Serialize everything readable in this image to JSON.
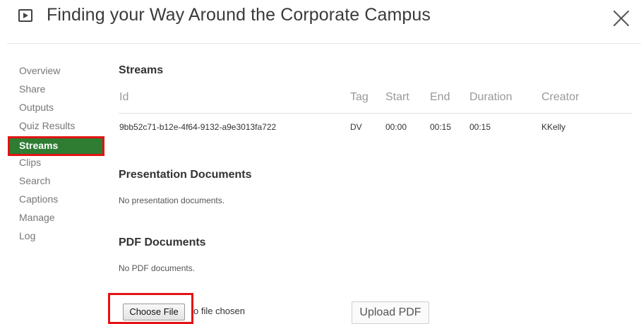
{
  "header": {
    "title": "Finding your Way Around the Corporate Campus",
    "play_icon": "play-icon",
    "close_icon": "close-icon"
  },
  "sidebar": {
    "items": [
      {
        "label": "Overview"
      },
      {
        "label": "Share"
      },
      {
        "label": "Outputs"
      },
      {
        "label": "Quiz Results"
      },
      {
        "label": "Streams",
        "active": true
      },
      {
        "label": "Clips"
      },
      {
        "label": "Search"
      },
      {
        "label": "Captions"
      },
      {
        "label": "Manage"
      },
      {
        "label": "Log"
      }
    ],
    "active_bg": "#2e7d32",
    "highlight_border": "#e31313"
  },
  "streams": {
    "title": "Streams",
    "columns": [
      "Id",
      "Tag",
      "Start",
      "End",
      "Duration",
      "Creator"
    ],
    "rows": [
      {
        "id": "9bb52c71-b12e-4f64-9132-a9e3013fa722",
        "tag": "DV",
        "start": "00:00",
        "end": "00:15",
        "duration": "00:15",
        "creator": "KKelly"
      }
    ]
  },
  "presentation_documents": {
    "title": "Presentation Documents",
    "empty_message": "No presentation documents."
  },
  "pdf_documents": {
    "title": "PDF Documents",
    "empty_message": "No PDF documents."
  },
  "upload": {
    "choose_file_label": "Choose File",
    "file_status": "o file chosen",
    "upload_label": "Upload PDF"
  }
}
